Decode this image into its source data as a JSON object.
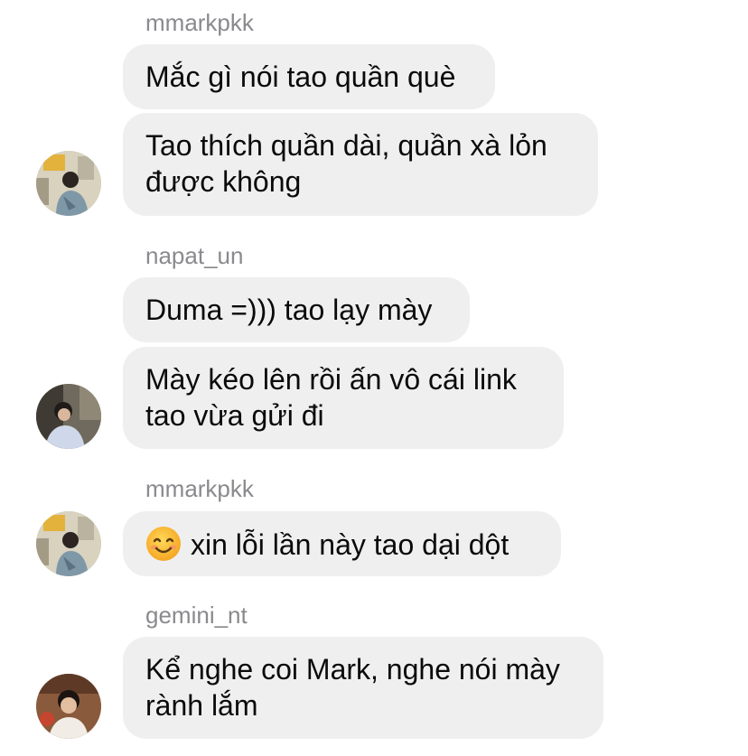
{
  "messages": [
    {
      "sender": "mmarkpkk",
      "bubbles": [
        {
          "lines": [
            "Mắc gì nói tao quần què"
          ]
        },
        {
          "lines": [
            "Tao thích quần dài, quần xà lỏn",
            "được không"
          ]
        }
      ]
    },
    {
      "sender": "napat_un",
      "bubbles": [
        {
          "lines": [
            "Duma =))) tao lạy mày"
          ]
        },
        {
          "lines": [
            "Mày kéo lên rồi ấn vô cái link",
            "tao vừa gửi đi"
          ]
        }
      ]
    },
    {
      "sender": "mmarkpkk",
      "bubbles": [
        {
          "emoji": "smiling-face-emoji",
          "lines": [
            "xin lỗi lần này tao dại dột"
          ]
        }
      ]
    },
    {
      "sender": "gemini_nt",
      "bubbles": [
        {
          "lines": [
            "Kể nghe coi Mark, nghe nói mày",
            "rành lắm"
          ]
        }
      ]
    }
  ],
  "colors": {
    "bubble_background": "#efefef",
    "sender_text": "#8a8a8e",
    "message_text": "#0a0a0a",
    "background": "#ffffff"
  }
}
